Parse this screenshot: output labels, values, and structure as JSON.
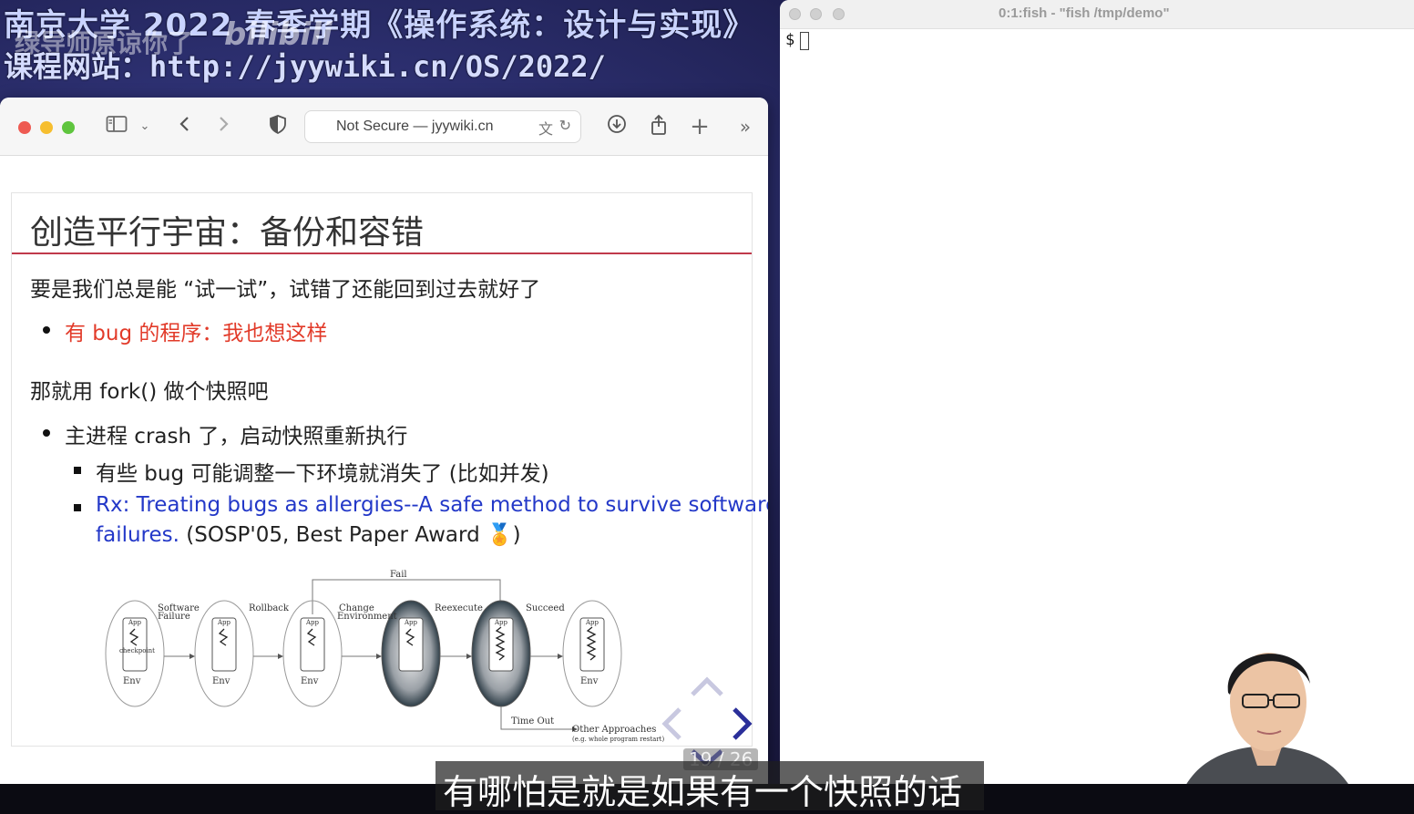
{
  "overlay": {
    "course_title": "南京大学 2022 春季学期《操作系统：设计与实现》",
    "course_url": "课程网站：http://jyywiki.cn/OS/2022/",
    "watermark": "绿导师原谅你了",
    "platform_logo": "bilibili"
  },
  "browser": {
    "url": "Not Secure — jyywiki.cn",
    "icons": [
      "sidebar-icon",
      "chevron-down-icon",
      "back-icon",
      "forward-icon",
      "shield-icon",
      "translate-icon",
      "reload-icon",
      "download-icon",
      "share-icon",
      "new-tab-icon",
      "more-icon"
    ]
  },
  "slide": {
    "title": "创造平行宇宙：备份和容错",
    "line1": "要是我们总是能 “试一试”，试错了还能回到过去就好了",
    "bullet1": "有 bug 的程序：我也想这样",
    "line2": "那就用 fork() 做个快照吧",
    "bullet2": "主进程 crash 了，启动快照重新执行",
    "sub1": "有些 bug 可能调整一下环境就消失了 (比如并发)",
    "sub2_link_a": "Rx: Treating bugs as allergies--A safe method to survive software",
    "sub2_link_b": "failures.",
    "sub2_tail": " (SOSP'05, Best Paper Award 🏅)",
    "page": "19 / 26",
    "diagram": {
      "labels": {
        "fail": "Fail",
        "software_failure_1": "Software",
        "software_failure_2": "Failure",
        "rollback": "Rollback",
        "change_env_1": "Change",
        "change_env_2": "Environment",
        "reexecute": "Reexecute",
        "succeed": "Succeed",
        "time_out": "Time Out",
        "other": "Other Approaches",
        "other_note": "(e.g. whole program restart)",
        "checkpoint": "checkpoint",
        "app": "App",
        "env": "Env"
      }
    }
  },
  "terminal": {
    "title": "0:1:fish - \"fish /tmp/demo\"",
    "prompt": "$"
  },
  "subtitle": "有哪怕是就是如果有一个快照的话",
  "colors": {
    "accent_red": "#c0394b",
    "bullet_red": "#e23b2a",
    "link_blue": "#2338c8"
  }
}
